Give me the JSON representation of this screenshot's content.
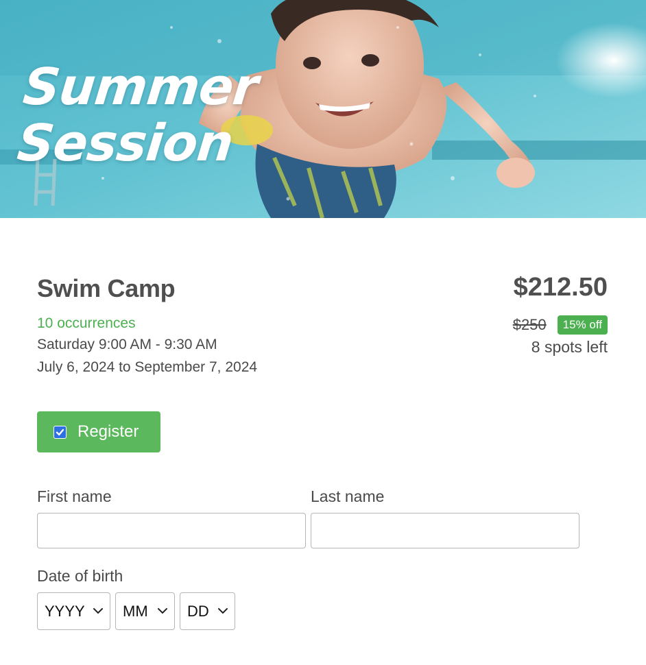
{
  "hero": {
    "title_line1": "Summer",
    "title_line2": "Session",
    "image_alt": "child swimming underwater"
  },
  "camp": {
    "name": "Swim Camp",
    "occurrences": "10 occurrences",
    "schedule": "Saturday 9:00 AM - 9:30 AM",
    "date_range": "July 6, 2024 to September 7, 2024"
  },
  "pricing": {
    "price": "$212.50",
    "original_price": "$250",
    "discount": "15% off",
    "spots_left": "8 spots left"
  },
  "register": {
    "label": "Register",
    "checked": true
  },
  "form": {
    "first_name_label": "First name",
    "first_name_value": "",
    "last_name_label": "Last name",
    "last_name_value": "",
    "dob_label": "Date of birth",
    "year_value": "YYYY",
    "month_value": "MM",
    "day_value": "DD"
  },
  "colors": {
    "accent_green": "#4caf50",
    "button_green": "#5cb85c",
    "checkbox_blue": "#2f6fe4",
    "text": "#4a4a4a"
  },
  "icons": [
    "checkmark-icon",
    "chevron-down-icon"
  ]
}
